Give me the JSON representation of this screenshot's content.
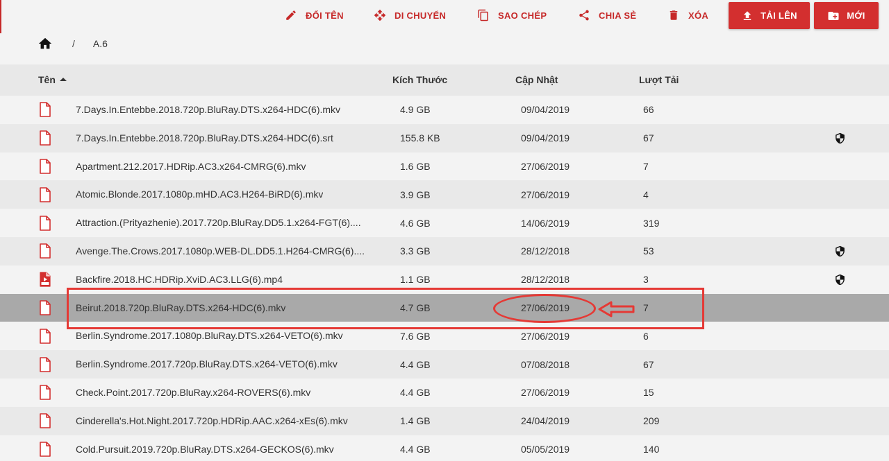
{
  "toolbar": {
    "rename": {
      "label": "ĐỔI TÊN",
      "icon": "pencil-icon"
    },
    "move": {
      "label": "DI CHUYỂN",
      "icon": "move-arrows-icon"
    },
    "copy": {
      "label": "SAO CHÉP",
      "icon": "copy-icon"
    },
    "share": {
      "label": "CHIA SẺ",
      "icon": "share-icon"
    },
    "delete": {
      "label": "XÓA",
      "icon": "trash-icon"
    },
    "upload": {
      "label": "TẢI LÊN",
      "icon": "upload-icon"
    },
    "new": {
      "label": "MỚI",
      "icon": "new-folder-icon"
    },
    "accent_color": "#d32f2f"
  },
  "breadcrumb": {
    "separator": "/",
    "current": "A.6"
  },
  "table": {
    "headers": {
      "name": "Tên",
      "size": "Kích Thước",
      "updated": "Cập Nhật",
      "downloads": "Lượt Tải"
    },
    "rows": [
      {
        "name": "7.Days.In.Entebbe.2018.720p.BluRay.DTS.x264-HDC(6).mkv",
        "size": "4.9 GB",
        "updated": "09/04/2019",
        "downloads": "66",
        "icon": "file-icon",
        "shield": false
      },
      {
        "name": "7.Days.In.Entebbe.2018.720p.BluRay.DTS.x264-HDC(6).srt",
        "size": "155.8 KB",
        "updated": "09/04/2019",
        "downloads": "67",
        "icon": "file-icon",
        "shield": true
      },
      {
        "name": "Apartment.212.2017.HDRip.AC3.x264-CMRG(6).mkv",
        "size": "1.6 GB",
        "updated": "27/06/2019",
        "downloads": "7",
        "icon": "file-icon",
        "shield": false
      },
      {
        "name": "Atomic.Blonde.2017.1080p.mHD.AC3.H264-BiRD(6).mkv",
        "size": "3.9 GB",
        "updated": "27/06/2019",
        "downloads": "4",
        "icon": "file-icon",
        "shield": false
      },
      {
        "name": "Attraction.(Prityazhenie).2017.720p.BluRay.DD5.1.x264-FGT(6)....",
        "size": "4.6 GB",
        "updated": "14/06/2019",
        "downloads": "319",
        "icon": "file-icon",
        "shield": false
      },
      {
        "name": "Avenge.The.Crows.2017.1080p.WEB-DL.DD5.1.H264-CMRG(6)....",
        "size": "3.3 GB",
        "updated": "28/12/2018",
        "downloads": "53",
        "icon": "file-icon",
        "shield": true
      },
      {
        "name": "Backfire.2018.HC.HDRip.XviD.AC3.LLG(6).mp4",
        "size": "1.1 GB",
        "updated": "28/12/2018",
        "downloads": "3",
        "icon": "video-file-icon",
        "shield": true
      },
      {
        "name": "Beirut.2018.720p.BluRay.DTS.x264-HDC(6).mkv",
        "size": "4.7 GB",
        "updated": "27/06/2019",
        "downloads": "7",
        "icon": "file-icon",
        "shield": false,
        "selected": true
      },
      {
        "name": "Berlin.Syndrome.2017.1080p.BluRay.DTS.x264-VETO(6).mkv",
        "size": "7.6 GB",
        "updated": "27/06/2019",
        "downloads": "6",
        "icon": "file-icon",
        "shield": false
      },
      {
        "name": "Berlin.Syndrome.2017.720p.BluRay.DTS.x264-VETO(6).mkv",
        "size": "4.4 GB",
        "updated": "07/08/2018",
        "downloads": "67",
        "icon": "file-icon",
        "shield": false
      },
      {
        "name": "Check.Point.2017.720p.BluRay.x264-ROVERS(6).mkv",
        "size": "4.4 GB",
        "updated": "27/06/2019",
        "downloads": "15",
        "icon": "file-icon",
        "shield": false
      },
      {
        "name": "Cinderella's.Hot.Night.2017.720p.HDRip.AAC.x264-xEs(6).mkv",
        "size": "1.4 GB",
        "updated": "24/04/2019",
        "downloads": "209",
        "icon": "file-icon",
        "shield": false
      },
      {
        "name": "Cold.Pursuit.2019.720p.BluRay.DTS.x264-GECKOS(6).mkv",
        "size": "4.4 GB",
        "updated": "05/05/2019",
        "downloads": "140",
        "icon": "file-icon",
        "shield": false
      }
    ]
  },
  "annotation_color": "#e53935"
}
